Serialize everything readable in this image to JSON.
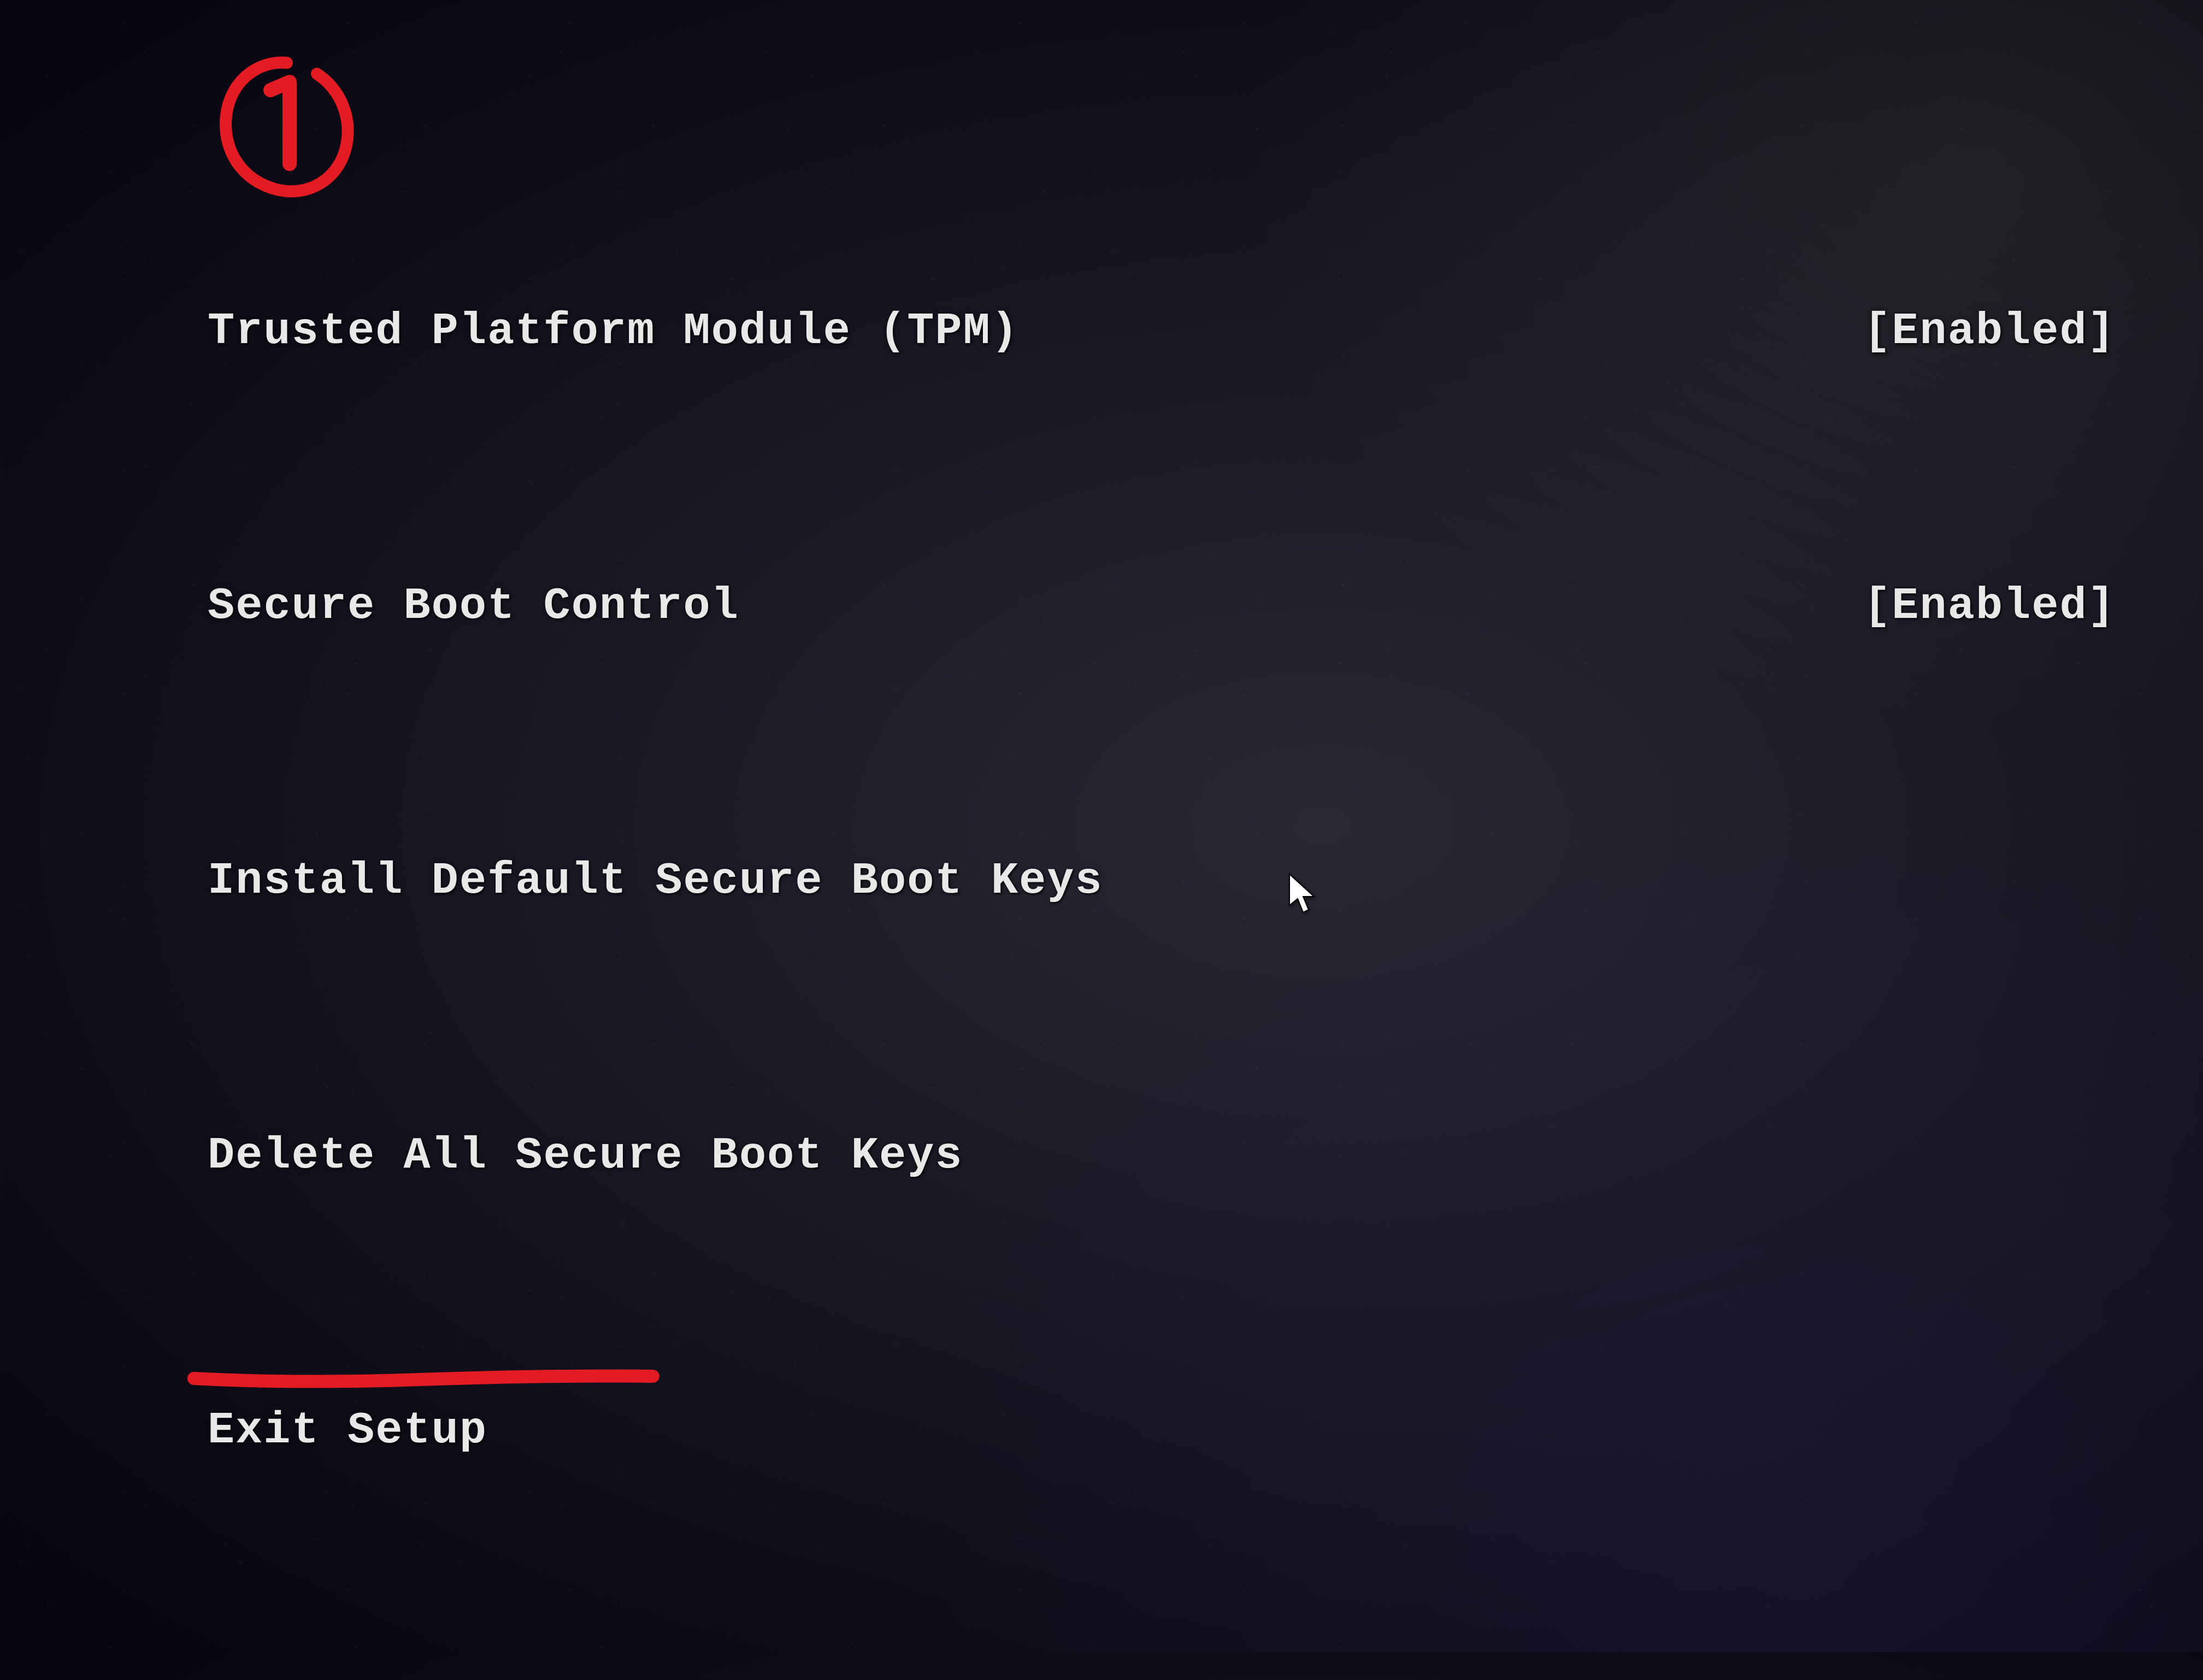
{
  "annotation": {
    "badge_number": "1",
    "color": "#e31b23"
  },
  "menu": {
    "items": [
      {
        "label": "Trusted Platform Module (TPM)",
        "value": "[Enabled]",
        "type": "setting"
      },
      {
        "label": "Secure Boot Control",
        "value": "[Enabled]",
        "type": "setting"
      },
      {
        "label": "Install Default Secure Boot Keys",
        "value": null,
        "type": "action"
      },
      {
        "label": "Delete All Secure Boot Keys",
        "value": null,
        "type": "action"
      },
      {
        "label": "Exit Setup",
        "value": null,
        "type": "action"
      }
    ]
  }
}
